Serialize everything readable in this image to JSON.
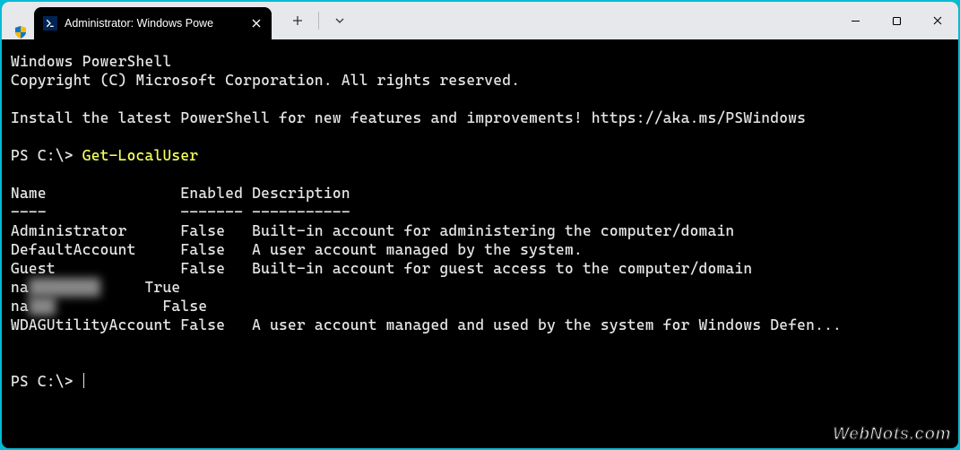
{
  "tab": {
    "title": "Administrator: Windows Powe"
  },
  "terminal": {
    "banner1": "Windows PowerShell",
    "banner2": "Copyright (C) Microsoft Corporation. All rights reserved.",
    "install": "Install the latest PowerShell for new features and improvements! https://aka.ms/PSWindows",
    "prompt1_ps": "PS C:\\> ",
    "prompt1_cmd": "Get-LocalUser",
    "header": "Name               Enabled Description",
    "divider": "----               ------- -----------",
    "rows": {
      "r0": "Administrator      False   Built-in account for administering the computer/domain",
      "r1": "DefaultAccount     False   A user account managed by the system.",
      "r2": "Guest              False   Built-in account for guest access to the computer/domain",
      "r3a": "na",
      "r3b": "████████",
      "r3c": "     True",
      "r4a": "na",
      "r4b": "███",
      "r4c": "            False",
      "r5": "WDAGUtilityAccount False   A user account managed and used by the system for Windows Defen..."
    },
    "prompt2_ps": "PS C:\\> "
  },
  "watermark": "WebNots.com"
}
